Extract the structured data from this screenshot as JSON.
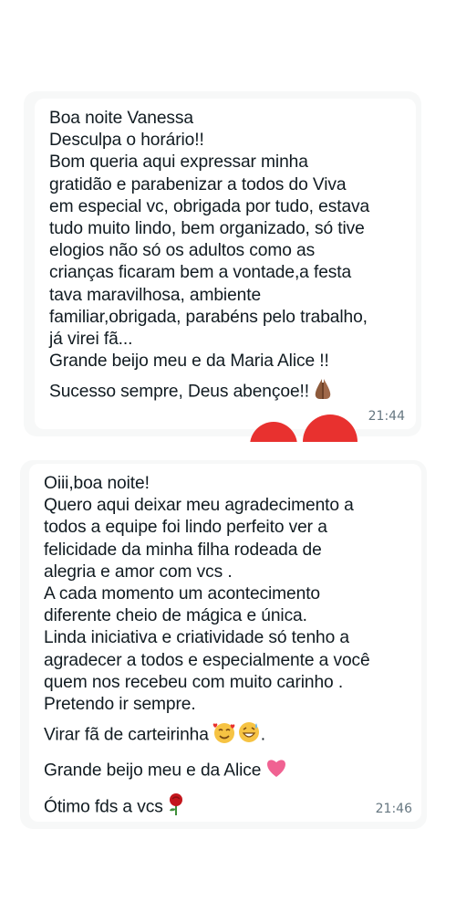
{
  "messages": [
    {
      "lines": [
        "Boa noite Vanessa",
        "Desculpa o horário!!",
        "Bom queria aqui expressar minha",
        "gratidão e parabenizar a todos do Viva",
        "em especial vc, obrigada por tudo, estava",
        "tudo muito lindo, bem organizado, só tive",
        "elogios não só os adultos como as",
        "crianças ficaram bem a vontade,a festa",
        "tava maravilhosa, ambiente",
        "familiar,obrigada, parabéns pelo trabalho,",
        "já virei fã...",
        "Grande beijo meu e da Maria Alice !!",
        "Sucesso sempre, Deus abençoe!!"
      ],
      "emoji_last_line": "folded-hands-icon",
      "time": "21:44"
    },
    {
      "lines": [
        "Oiii,boa noite!",
        "Quero aqui deixar meu agradecimento a",
        "todos a equipe foi lindo perfeito ver a",
        "felicidade da minha filha rodeada de",
        "alegria e amor com vcs .",
        "A cada momento um acontecimento",
        "diferente cheio de mágica e única.",
        "Linda iniciativa e criatividade só tenho a",
        "agradecer a todos e especialmente a você",
        "quem nos recebeu com muito carinho .",
        "Pretendo ir sempre.",
        "Virar fã de carteirinha",
        "Grande beijo meu e da Alice",
        "Ótimo fds a vcs"
      ],
      "line_suffix_12": ".",
      "emojis": [
        "smiling-face-with-hearts-icon",
        "grinning-sweat-icon",
        "pink-heart-icon",
        "rose-icon"
      ],
      "time": "21:46"
    }
  ],
  "colors": {
    "text": "#111b21",
    "time": "#667781",
    "card": "#f7f8f8",
    "heart": "#e8312f"
  }
}
